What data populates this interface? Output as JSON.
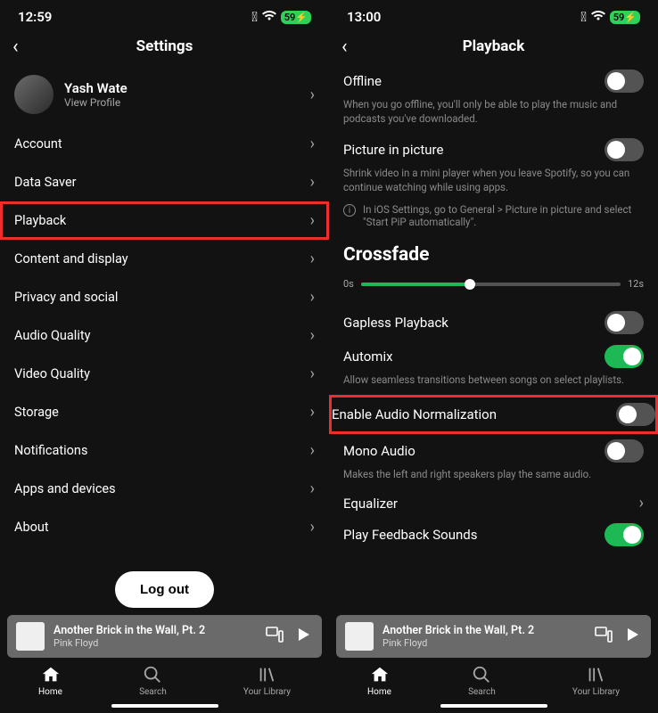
{
  "left": {
    "status": {
      "time": "12:59",
      "battery": "59"
    },
    "header": {
      "title": "Settings"
    },
    "profile": {
      "name": "Yash Wate",
      "sub": "View Profile"
    },
    "menu": [
      {
        "label": "Account",
        "highlighted": false
      },
      {
        "label": "Data Saver",
        "highlighted": false
      },
      {
        "label": "Playback",
        "highlighted": true
      },
      {
        "label": "Content and display",
        "highlighted": false
      },
      {
        "label": "Privacy and social",
        "highlighted": false
      },
      {
        "label": "Audio Quality",
        "highlighted": false
      },
      {
        "label": "Video Quality",
        "highlighted": false
      },
      {
        "label": "Storage",
        "highlighted": false
      },
      {
        "label": "Notifications",
        "highlighted": false
      },
      {
        "label": "Apps and devices",
        "highlighted": false
      },
      {
        "label": "About",
        "highlighted": false
      }
    ],
    "logout": "Log out",
    "now_playing": {
      "title": "Another Brick in the Wall, Pt. 2",
      "artist": "Pink Floyd"
    },
    "tabs": {
      "home": "Home",
      "search": "Search",
      "library": "Your Library"
    }
  },
  "right": {
    "status": {
      "time": "13:00",
      "battery": "59"
    },
    "header": {
      "title": "Playback"
    },
    "offline": {
      "label": "Offline",
      "desc": "When you go offline, you'll only be able to play the music and podcasts you've downloaded."
    },
    "pip": {
      "label": "Picture in picture",
      "desc": "Shrink video in a mini player when you leave Spotify, so you can continue watching while using apps.",
      "info": "In iOS Settings, go to General > Picture in picture and select \"Start PiP automatically\"."
    },
    "crossfade": {
      "title": "Crossfade",
      "min": "0s",
      "max": "12s"
    },
    "gapless": {
      "label": "Gapless Playback"
    },
    "automix": {
      "label": "Automix",
      "desc": "Allow seamless transitions between songs on select playlists."
    },
    "normalization": {
      "label": "Enable Audio Normalization"
    },
    "mono": {
      "label": "Mono Audio",
      "desc": "Makes the left and right speakers play the same audio."
    },
    "equalizer": {
      "label": "Equalizer"
    },
    "feedback": {
      "label": "Play Feedback Sounds"
    },
    "now_playing": {
      "title": "Another Brick in the Wall, Pt. 2",
      "artist": "Pink Floyd"
    },
    "tabs": {
      "home": "Home",
      "search": "Search",
      "library": "Your Library"
    }
  }
}
